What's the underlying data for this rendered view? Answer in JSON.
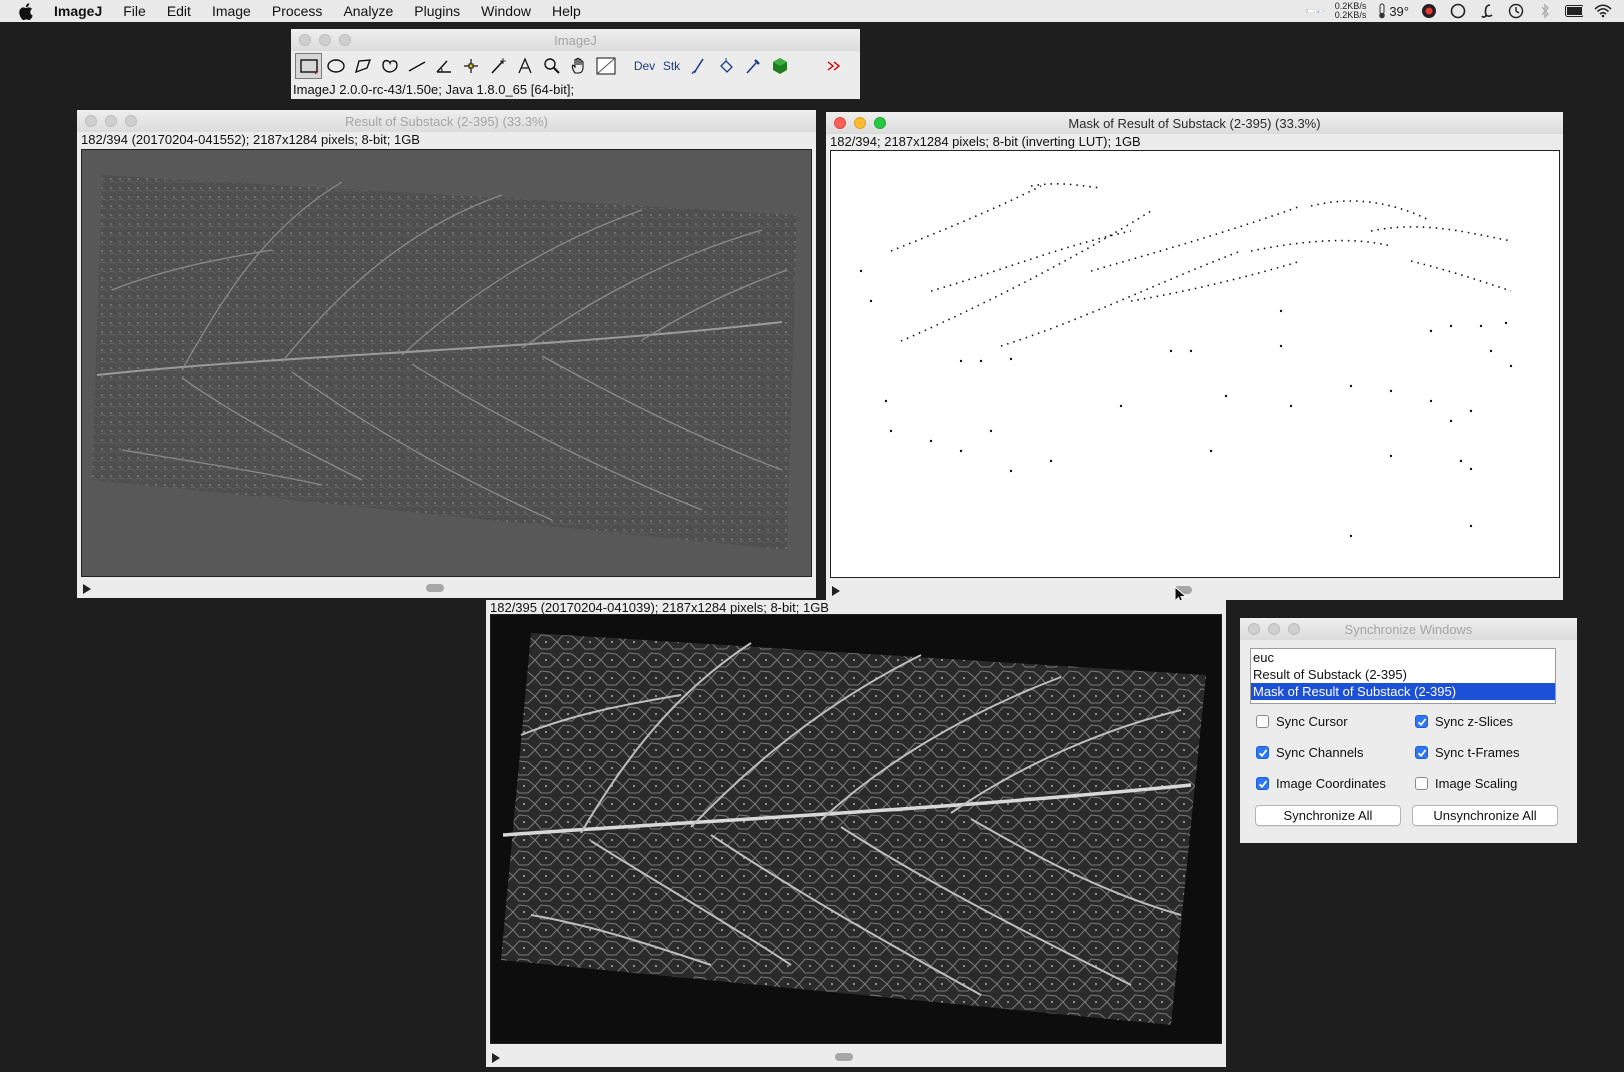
{
  "menubar": {
    "app_name": "ImageJ",
    "items": [
      "File",
      "Edit",
      "Image",
      "Process",
      "Analyze",
      "Plugins",
      "Window",
      "Help"
    ],
    "net_up": "0.2KB/s",
    "net_down": "0.2KB/s",
    "temperature": "39°",
    "icons": [
      "apple-logo-icon",
      "cpu-graph-icon",
      "network-speed-icon",
      "temperature-icon",
      "record-icon",
      "circle-app-icon",
      "script-l-icon",
      "time-machine-icon",
      "bluetooth-icon",
      "battery-icon",
      "wifi-icon"
    ]
  },
  "toolbar_window": {
    "title": "ImageJ",
    "tools": [
      "rectangle-tool-icon",
      "oval-tool-icon",
      "polygon-tool-icon",
      "freehand-tool-icon",
      "line-tool-icon",
      "angle-tool-icon",
      "point-tool-icon",
      "wand-tool-icon",
      "text-tool-icon",
      "magnifier-tool-icon",
      "hand-tool-icon",
      "color-picker-tool-icon",
      "dev-tool",
      "stk-tool",
      "brush-tool-icon",
      "flood-fill-tool-icon",
      "pipette-tool-icon",
      "hexagon-tool-icon",
      "blank-tool",
      "more-tools-icon"
    ],
    "dev_label": "Dev",
    "stk_label": "Stk",
    "status": "ImageJ 2.0.0-rc-43/1.50e; Java 1.8.0_65 [64-bit];"
  },
  "window_result": {
    "title": "Result of Substack (2-395) (33.3%)",
    "info": "182/394 (20170204-041552); 2187x1284 pixels; 8-bit; 1GB",
    "slice_position": 0.47
  },
  "window_mask": {
    "title": "Mask of Result of Substack (2-395) (33.3%)",
    "info": "182/394; 2187x1284 pixels; 8-bit (inverting LUT); 1GB",
    "slice_position": 0.47
  },
  "window_euc": {
    "info": "182/395 (20170204-041039); 2187x1284 pixels; 8-bit; 1GB",
    "slice_position": 0.47
  },
  "sync_dialog": {
    "title": "Synchronize Windows",
    "list": [
      "euc",
      "Result of Substack (2-395)",
      "Mask of Result of Substack (2-395)"
    ],
    "selected_index": 2,
    "options": {
      "sync_cursor": {
        "label": "Sync Cursor",
        "checked": false
      },
      "sync_z": {
        "label": "Sync z-Slices",
        "checked": true
      },
      "sync_channels": {
        "label": "Sync Channels",
        "checked": true
      },
      "sync_t": {
        "label": "Sync t-Frames",
        "checked": true
      },
      "image_coords": {
        "label": "Image Coordinates",
        "checked": true
      },
      "image_scaling": {
        "label": "Image Scaling",
        "checked": false
      }
    },
    "sync_all_label": "Synchronize All",
    "unsync_all_label": "Unsynchronize All"
  },
  "colors": {
    "accent": "#1c50d6",
    "checkbox": "#2d76f5"
  }
}
